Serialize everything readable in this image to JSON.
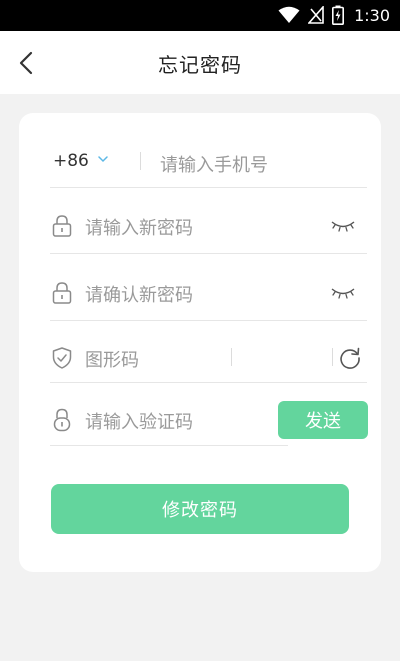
{
  "status_bar": {
    "time": "1:30",
    "icons": [
      "wifi-icon",
      "signal-icon",
      "battery-icon"
    ]
  },
  "header": {
    "title": "忘记密码",
    "back_icon": "chevron-left-icon"
  },
  "form": {
    "phone": {
      "country_code": "+86",
      "placeholder": "请输入手机号"
    },
    "new_password": {
      "placeholder": "请输入新密码",
      "icon": "lock-icon",
      "toggle_icon": "eye-closed-icon"
    },
    "confirm_password": {
      "placeholder": "请确认新密码",
      "icon": "lock-icon",
      "toggle_icon": "eye-closed-icon"
    },
    "captcha": {
      "placeholder": "图形码",
      "icon": "shield-check-icon",
      "refresh_icon": "refresh-icon"
    },
    "verification": {
      "placeholder": "请输入验证码",
      "icon": "lock-icon",
      "send_label": "发送"
    },
    "submit_label": "修改密码"
  },
  "colors": {
    "accent": "#63d59d",
    "background": "#f2f2f2",
    "card": "#ffffff",
    "placeholder": "#9a9a9a"
  }
}
